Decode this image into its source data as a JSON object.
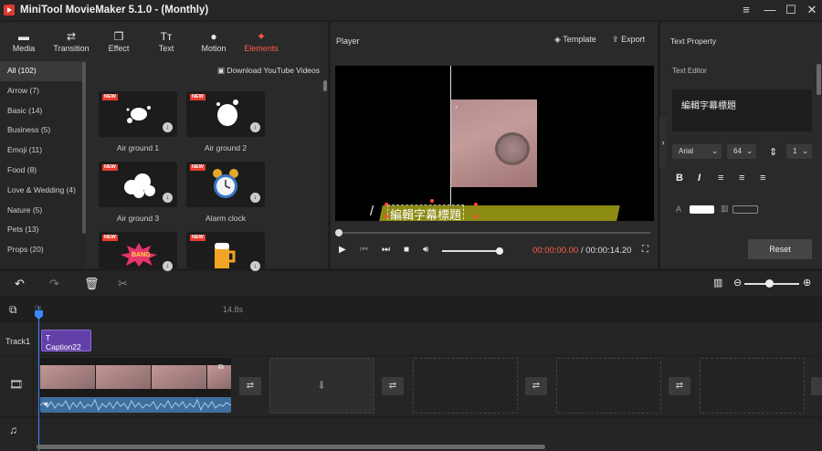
{
  "window": {
    "title": "MiniTool MovieMaker 5.1.0 - (Monthly)",
    "controls": [
      "≡",
      "—",
      "☐",
      "✕"
    ]
  },
  "nav": {
    "tabs": [
      {
        "label": "Media",
        "icon": "folder-icon",
        "glyph": "▬"
      },
      {
        "label": "Transition",
        "icon": "transition-icon",
        "glyph": "⇄"
      },
      {
        "label": "Effect",
        "icon": "effect-icon",
        "glyph": "❐"
      },
      {
        "label": "Text",
        "icon": "text-icon",
        "glyph": "Tт"
      },
      {
        "label": "Motion",
        "icon": "motion-icon",
        "glyph": "●"
      },
      {
        "label": "Elements",
        "icon": "elements-icon",
        "glyph": "✦"
      }
    ],
    "active": "Elements"
  },
  "categories": [
    {
      "label": "All (102)"
    },
    {
      "label": "Arrow (7)"
    },
    {
      "label": "Basic (14)"
    },
    {
      "label": "Business (5)"
    },
    {
      "label": "Emoji (11)"
    },
    {
      "label": "Food (8)"
    },
    {
      "label": "Love & Wedding (4)"
    },
    {
      "label": "Nature (5)"
    },
    {
      "label": "Pets (13)"
    },
    {
      "label": "Props (20)"
    }
  ],
  "elements": {
    "download_label": "Download YouTube Videos",
    "new_tag": "NEW",
    "items": [
      {
        "label": "Air ground 1"
      },
      {
        "label": "Air ground 2"
      },
      {
        "label": "Air ground 3"
      },
      {
        "label": "Alarm clock"
      },
      {
        "label": ""
      },
      {
        "label": ""
      }
    ],
    "bang_text": "BANG"
  },
  "player": {
    "title": "Player",
    "template_label": "Template",
    "export_label": "Export",
    "caption_text": "編輯字幕標題",
    "caption_slash": "/",
    "time_current": "00:00:00.00",
    "time_sep": " / ",
    "time_total": "00:00:14.20",
    "volume_fraction": 0.95,
    "progress_fraction": 0.0
  },
  "text_property": {
    "title": "Text Property",
    "editor_label": "Text Editor",
    "editor_value": "編輯字幕標題",
    "font": "Arial",
    "size": "64",
    "line_spacing": "1",
    "reset_label": "Reset"
  },
  "timeline": {
    "ruler_start": "0s",
    "ruler_mark": "14.8s",
    "track1_label": "Track1",
    "caption_clip_label": "Caption22",
    "zoom_fraction": 0.45
  },
  "colors": {
    "accent": "#ff5a4c",
    "caption_bar": "#8c8b14",
    "caption_clip": "#6240a8",
    "playhead": "#3d88ff"
  }
}
